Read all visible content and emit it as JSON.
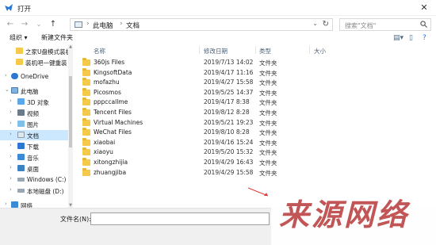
{
  "window": {
    "title": "打开",
    "close_glyph": "✕"
  },
  "nav": {
    "back": "←",
    "forward": "→",
    "dropdown": "⌄",
    "up": "↑",
    "breadcrumb": [
      "此电脑",
      "文档"
    ],
    "separator": "›",
    "address_dropdown": "⌄",
    "refresh": "↻",
    "search_placeholder": "搜索\"文档\""
  },
  "toolbar": {
    "organize": "组织 ▾",
    "new_folder": "新建文件夹",
    "view_glyph": "▤▾",
    "pane_glyph": "▯",
    "help_glyph": "?"
  },
  "sidebar": {
    "items": [
      {
        "label": "之家U盘模式装机",
        "kind": "folder",
        "selected": false
      },
      {
        "label": "装机吧一键重装",
        "kind": "folder",
        "selected": false
      },
      {
        "label": "OneDrive",
        "kind": "cloud",
        "selected": false
      },
      {
        "label": "此电脑",
        "kind": "pc",
        "selected": false
      },
      {
        "label": "3D 对象",
        "kind": "3d",
        "selected": false
      },
      {
        "label": "视频",
        "kind": "video",
        "selected": false
      },
      {
        "label": "图片",
        "kind": "picture",
        "selected": false
      },
      {
        "label": "文档",
        "kind": "doc",
        "selected": true
      },
      {
        "label": "下载",
        "kind": "download",
        "selected": false
      },
      {
        "label": "音乐",
        "kind": "music",
        "selected": false
      },
      {
        "label": "桌面",
        "kind": "desktop",
        "selected": false
      },
      {
        "label": "Windows (C:)",
        "kind": "drive",
        "selected": false
      },
      {
        "label": "本地磁盘 (D:)",
        "kind": "drive",
        "selected": false
      },
      {
        "label": "网络",
        "kind": "network",
        "selected": false
      }
    ]
  },
  "columns": [
    "名称",
    "修改日期",
    "类型",
    "大小"
  ],
  "files": [
    {
      "name": "360js Files",
      "date": "2019/7/13 14:02",
      "type": "文件夹"
    },
    {
      "name": "KingsoftData",
      "date": "2019/4/17 11:16",
      "type": "文件夹"
    },
    {
      "name": "mofazhu",
      "date": "2019/4/27 15:58",
      "type": "文件夹"
    },
    {
      "name": "Picosmos",
      "date": "2019/5/25 14:37",
      "type": "文件夹"
    },
    {
      "name": "pppccallme",
      "date": "2019/4/17 8:38",
      "type": "文件夹"
    },
    {
      "name": "Tencent Files",
      "date": "2019/8/12 8:28",
      "type": "文件夹"
    },
    {
      "name": "Virtual Machines",
      "date": "2019/5/21 19:23",
      "type": "文件夹"
    },
    {
      "name": "WeChat Files",
      "date": "2019/8/10 8:28",
      "type": "文件夹"
    },
    {
      "name": "xiaobai",
      "date": "2019/4/16 15:24",
      "type": "文件夹"
    },
    {
      "name": "xiaoyu",
      "date": "2019/5/20 15:32",
      "type": "文件夹"
    },
    {
      "name": "xitongzhijia",
      "date": "2019/4/29 16:43",
      "type": "文件夹"
    },
    {
      "name": "zhuangjiba",
      "date": "2019/4/29 15:58",
      "type": "文件夹"
    }
  ],
  "filename": {
    "label": "文件名(N):",
    "value": ""
  },
  "watermark": {
    "text": "来源网络"
  },
  "colors": {
    "selection": "#cce8ff",
    "folder": "#f5c94a",
    "header_text": "#4c607a",
    "watermark": "#c25656",
    "arrow": "#e03b3b"
  }
}
